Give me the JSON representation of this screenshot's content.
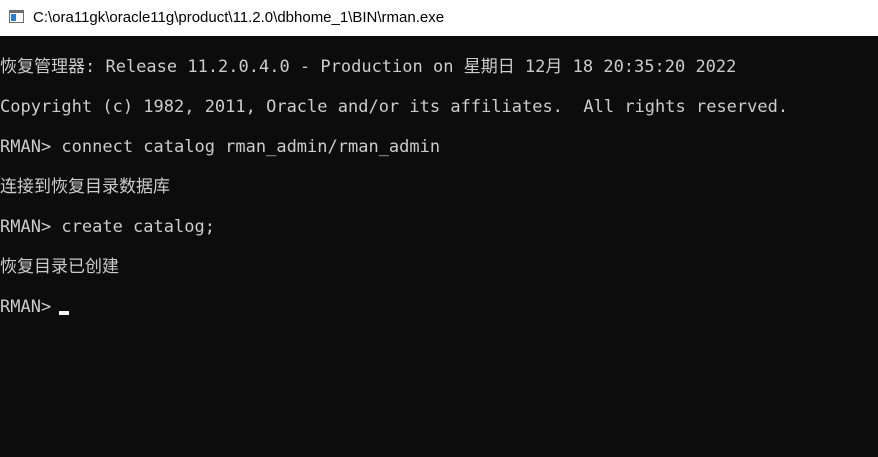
{
  "window": {
    "title": "C:\\ora11gk\\oracle11g\\product\\11.2.0\\dbhome_1\\BIN\\rman.exe"
  },
  "console": {
    "lines": [
      "恢复管理器: Release 11.2.0.4.0 - Production on 星期日 12月 18 20:35:20 2022",
      "Copyright (c) 1982, 2011, Oracle and/or its affiliates.  All rights reserved.",
      "RMAN> connect catalog rman_admin/rman_admin",
      "连接到恢复目录数据库",
      "RMAN> create catalog;",
      "恢复目录已创建"
    ],
    "prompt": "RMAN>"
  },
  "colors": {
    "console_background": "#0c0c0c",
    "console_text": "#cccccc",
    "titlebar_background": "#ffffff"
  }
}
